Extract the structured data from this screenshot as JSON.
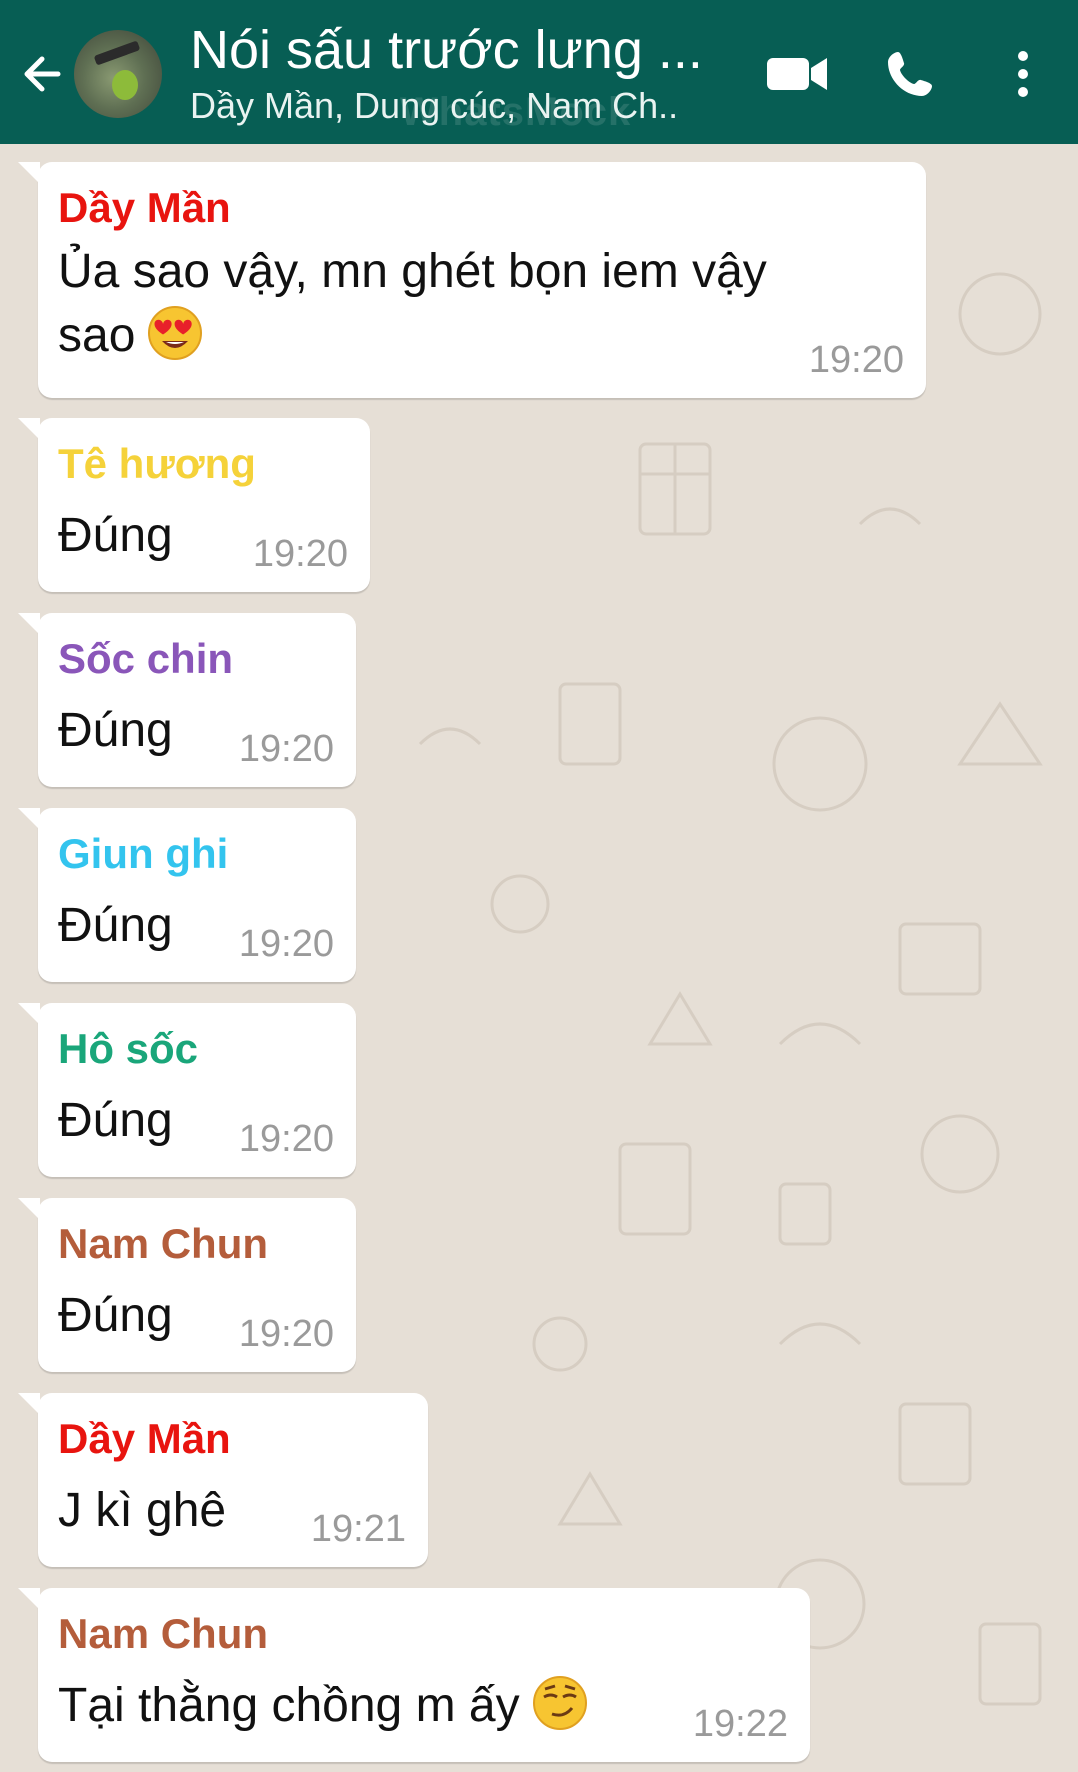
{
  "header": {
    "title": "Nói sấu trước lưng ...",
    "subtitle": "Dầy Mần, Dung cúc, Nam Ch..",
    "watermark": "WhatsMock"
  },
  "messages": [
    {
      "sender": "Dầy Mần",
      "sender_color": "#e8140f",
      "text_line1": "Ủa sao vậy, mn ghét bọn iem vậy",
      "text_line2": "sao",
      "emoji": "heart-eyes-emoji",
      "time": "19:20"
    },
    {
      "sender": "Tê hương",
      "sender_color": "#f5d23a",
      "text": "Đúng",
      "time": "19:20"
    },
    {
      "sender": "Sốc chin",
      "sender_color": "#8a56b9",
      "text": "Đúng",
      "time": "19:20"
    },
    {
      "sender": "Giun ghi",
      "sender_color": "#33c4ee",
      "text": "Đúng",
      "time": "19:20"
    },
    {
      "sender": "Hô sốc",
      "sender_color": "#1aa67a",
      "text": "Đúng",
      "time": "19:20"
    },
    {
      "sender": "Nam Chun",
      "sender_color": "#b45d3b",
      "text": "Đúng",
      "time": "19:20"
    },
    {
      "sender": "Dầy Mần",
      "sender_color": "#e8140f",
      "text": "J kì ghê",
      "time": "19:21"
    },
    {
      "sender": "Nam Chun",
      "sender_color": "#b45d3b",
      "text": "Tại thằng chồng m ấy",
      "emoji": "smirk-emoji",
      "time": "19:22"
    }
  ]
}
